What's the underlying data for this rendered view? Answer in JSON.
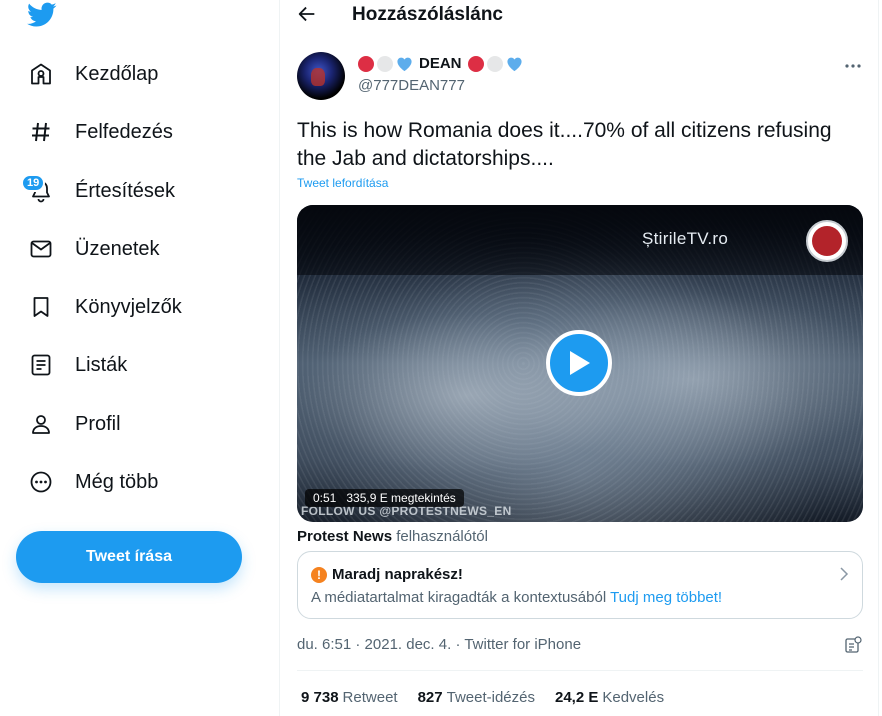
{
  "sidebar": {
    "nav": [
      {
        "label": "Kezdőlap",
        "icon": "home-icon"
      },
      {
        "label": "Felfedezés",
        "icon": "hashtag-icon"
      },
      {
        "label": "Értesítések",
        "icon": "bell-icon"
      },
      {
        "label": "Üzenetek",
        "icon": "mail-icon"
      },
      {
        "label": "Könyvjelzők",
        "icon": "bookmark-icon"
      },
      {
        "label": "Listák",
        "icon": "list-icon"
      },
      {
        "label": "Profil",
        "icon": "profile-icon"
      },
      {
        "label": "Még több",
        "icon": "more-circle-icon"
      }
    ],
    "notification_count": "19",
    "tweet_button": "Tweet írása"
  },
  "header": {
    "title": "Hozzászóláslánc"
  },
  "tweet": {
    "display_name": "DEAN",
    "handle": "@777DEAN777",
    "text": "This is how Romania does it....70% of all citizens refusing the Jab and dictatorships....",
    "translate_label": "Tweet lefordítása",
    "video": {
      "watermark": "ȘtirileTV.ro",
      "duration": "0:51",
      "views": "335,9 E megtekintés",
      "overlay_text": "FOLLOW US @PROTESTNEWS_EN"
    },
    "source": {
      "name": "Protest News",
      "suffix": "felhasználótól"
    },
    "notice": {
      "title": "Maradj naprakész!",
      "text": "A médiatartalmat kiragadták a kontextusából",
      "link": "Tudj meg többet!"
    },
    "timestamp": "du. 6:51 · 2021. dec. 4. · Twitter for iPhone",
    "stats": {
      "retweets": "9 738",
      "retweets_label": "Retweet",
      "quotes": "827",
      "quotes_label": "Tweet-idézés",
      "likes": "24,2 E",
      "likes_label": "Kedvelés"
    }
  },
  "colors": {
    "accent": "#1d9bf0",
    "text_primary": "#0f1419",
    "text_secondary": "#536471",
    "warning": "#f5821f"
  }
}
